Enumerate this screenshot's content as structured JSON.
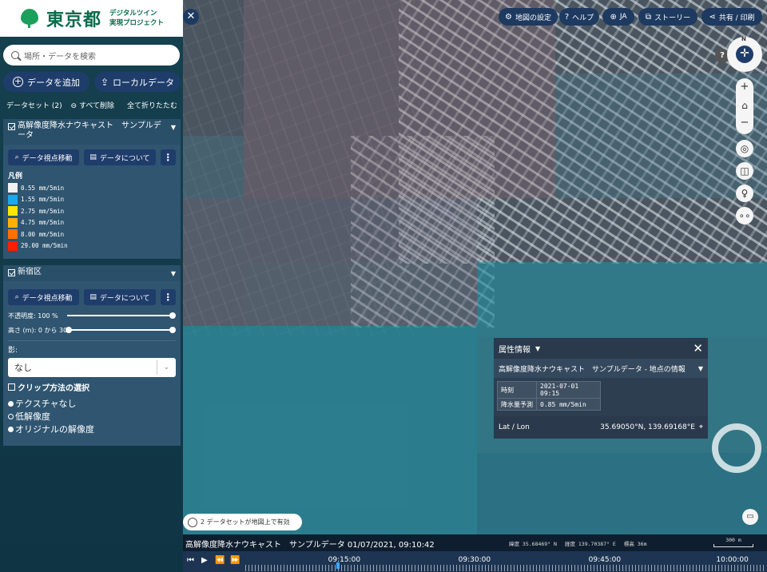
{
  "brand": {
    "name": "東京都",
    "tagline_line1": "デジタルツイン",
    "tagline_line2": "実現プロジェクト"
  },
  "search": {
    "placeholder": "場所・データを検索"
  },
  "actions": {
    "add_data": "データを追加",
    "local_data": "ローカルデータ"
  },
  "datasets_header": {
    "title": "データセット (2)",
    "remove_all": "すべて削除",
    "collapse_all": "全て折りたたむ"
  },
  "dataset1": {
    "title": "高解像度降水ナウキャスト　サンプルデータ",
    "checked": true,
    "zoom_button": "データ視点移動",
    "about_button": "データについて",
    "legend_title": "凡例",
    "legend": [
      {
        "label": "0.55 mm/5min",
        "color": "#f2f2f2"
      },
      {
        "label": "1.55 mm/5min",
        "color": "#19a9f0"
      },
      {
        "label": "2.75 mm/5min",
        "color": "#ffe600"
      },
      {
        "label": "4.75 mm/5min",
        "color": "#ffb000"
      },
      {
        "label": "8.00 mm/5min",
        "color": "#ff7000"
      },
      {
        "label": "29.00 mm/5min",
        "color": "#ff1e00"
      }
    ]
  },
  "dataset2": {
    "title": "新宿区",
    "checked": true,
    "zoom_button": "データ視点移動",
    "about_button": "データについて",
    "opacity_label": "不透明度: 100 %",
    "opacity_value": 1.0,
    "height_label": "高さ (m): 0 から 300",
    "shadow_label": "影:",
    "shadow_value": "なし",
    "clip_label": "クリップ方法の選択",
    "resolution_options": [
      {
        "label": "テクスチャなし",
        "selected": true
      },
      {
        "label": "低解像度",
        "selected": false
      },
      {
        "label": "オリジナルの解像度",
        "selected": true
      }
    ]
  },
  "topbar": {
    "map_settings": "地図の設定",
    "help": "ヘルプ",
    "language": "JA",
    "story": "ストーリー",
    "share": "共有 / 印刷"
  },
  "compass": {
    "north": "N"
  },
  "info_panel": {
    "title": "属性情報",
    "subtitle": "高解像度降水ナウキャスト　サンプルデータ - 地点の情報",
    "rows": [
      {
        "key": "時刻",
        "value": "2021-07-01 09:15"
      },
      {
        "key": "降水量予測",
        "value": "0.85 mm/5min"
      }
    ],
    "latlon_label": "Lat / Lon",
    "latlon_value": "35.69050°N, 139.69168°E"
  },
  "active_note": "2 データセットが地図上で有効",
  "status": {
    "title": "高解像度降水ナウキャスト　サンプルデータ 01/07/2021, 09:10:42",
    "lat": "緯度  35.68469° N",
    "lon": "経度  139.70387° E",
    "elev": "標高  36m",
    "scale": "300 m"
  },
  "timeline": {
    "ticks": [
      "09:15:00",
      "09:30:00",
      "09:45:00",
      "10:00:00"
    ],
    "progress": 0.175
  }
}
